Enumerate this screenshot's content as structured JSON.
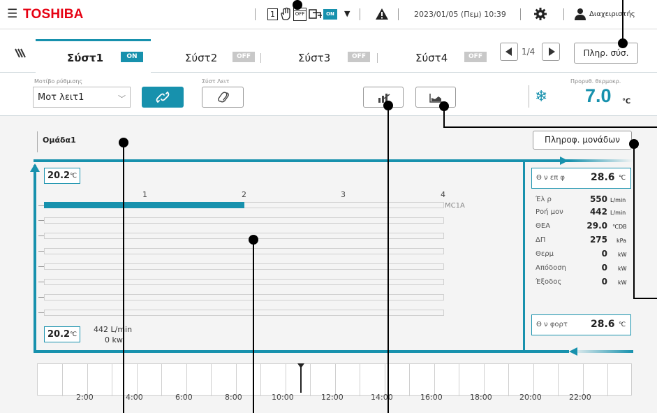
{
  "header": {
    "brand": "TOSHIBA",
    "status_icons": {
      "box1": "1",
      "hand": "hand-icon",
      "off_schedule": "OFF",
      "on_box": "ON"
    },
    "datetime": "2023/01/05 (Πεμ) 10:39",
    "user": "Διαχειριστής"
  },
  "tabs": [
    {
      "label": "Σύστ1",
      "status": "ON"
    },
    {
      "label": "Σύστ2",
      "status": "OFF"
    },
    {
      "label": "Σύστ3",
      "status": "OFF"
    },
    {
      "label": "Σύστ4",
      "status": "OFF"
    }
  ],
  "pagination": {
    "label": "1/4"
  },
  "system_info_button": "Πληρ. σύσ.",
  "controls": {
    "mode_label": "Μοτίβο ρύθμισης",
    "mode_value": "Μοτ λειτ1",
    "link_label": "Σύστ Λειτ",
    "setpoint_label": "Προρυθ. θερμοκρ.",
    "setpoint_value": "7.0",
    "setpoint_unit": "℃"
  },
  "group": {
    "name": "Ομάδα1",
    "unit_info_button": "Πληροφ. μονάδων",
    "inlet_temp": "20.2",
    "outlet_temp": "20.2",
    "temp_unit": "℃",
    "flow": "442 L/min",
    "power": "0 kw",
    "scale_labels": [
      "1",
      "2",
      "3",
      "4"
    ],
    "unit_name": "MC1A",
    "unit_level": 2
  },
  "info_panel": {
    "supply_label": "Θ ν επ φ",
    "supply_value": "28.6",
    "supply_unit": "℃",
    "rows": [
      {
        "label": "Έλ ρ",
        "value": "550",
        "unit": "L/min"
      },
      {
        "label": "Ροή μον",
        "value": "442",
        "unit": "L/min"
      },
      {
        "label": "ΘΕΑ",
        "value": "29.0",
        "unit": "℃DB"
      },
      {
        "label": "ΔΠ",
        "value": "275",
        "unit": "kPa"
      },
      {
        "label": "Θερμ",
        "value": "0",
        "unit": "kW"
      },
      {
        "label": "Απόδοση",
        "value": "0",
        "unit": "kW"
      },
      {
        "label": "Έξοδος",
        "value": "0",
        "unit": "kW"
      }
    ],
    "load_label": "Θ ν φορτ",
    "load_value": "28.6",
    "load_unit": "℃"
  },
  "timeline": {
    "labels": [
      "2:00",
      "4:00",
      "6:00",
      "8:00",
      "10:00",
      "12:00",
      "14:00",
      "16:00",
      "18:00",
      "20:00",
      "22:00"
    ]
  }
}
